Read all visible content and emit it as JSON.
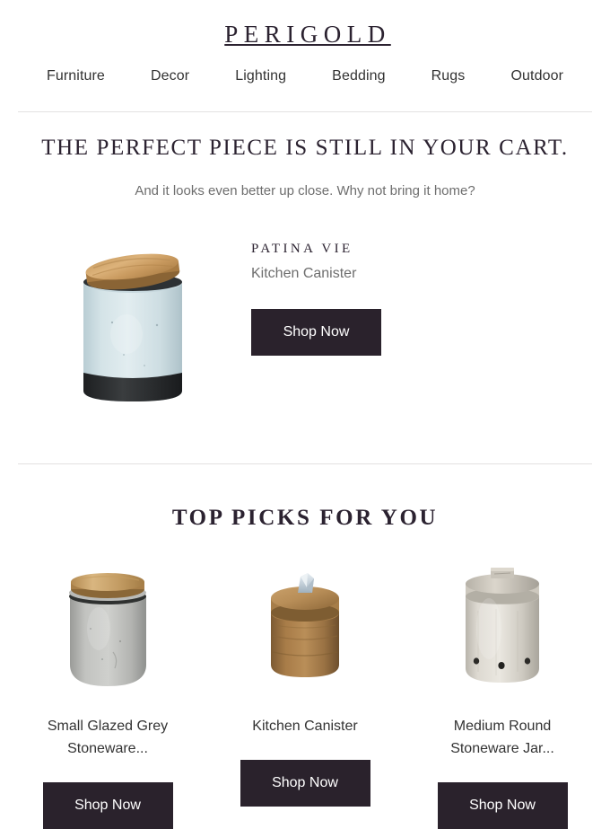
{
  "header": {
    "logo": "PERIGOLD",
    "nav": [
      {
        "label": "Furniture"
      },
      {
        "label": "Decor"
      },
      {
        "label": "Lighting"
      },
      {
        "label": "Bedding"
      },
      {
        "label": "Rugs"
      },
      {
        "label": "Outdoor"
      }
    ]
  },
  "hero": {
    "title": "THE PERFECT PIECE IS STILL IN YOUR CART.",
    "subtitle": "And it looks even better up close. Why not bring it home?"
  },
  "feature": {
    "brand": "PATINA VIE",
    "product_name": "Kitchen Canister",
    "cta_label": "Shop Now",
    "image_alt": "pale-blue-ceramic-canister-with-wood-lid"
  },
  "top_picks": {
    "title": "TOP PICKS FOR YOU",
    "items": [
      {
        "title": "Small Glazed Grey Stoneware...",
        "cta_label": "Shop Now",
        "image_alt": "grey-stoneware-canister-wood-lid"
      },
      {
        "title": "Kitchen Canister",
        "cta_label": "Shop Now",
        "image_alt": "wooden-canister-with-crystal-knob"
      },
      {
        "title": "Medium Round Stoneware Jar...",
        "cta_label": "Shop Now",
        "image_alt": "whitewashed-stoneware-jar-with-lid"
      }
    ]
  },
  "colors": {
    "accent_dark": "#2a222c",
    "text_primary": "#333333",
    "text_muted": "#6e6e6e",
    "rule": "#e3e1e1",
    "background": "#ffffff"
  }
}
